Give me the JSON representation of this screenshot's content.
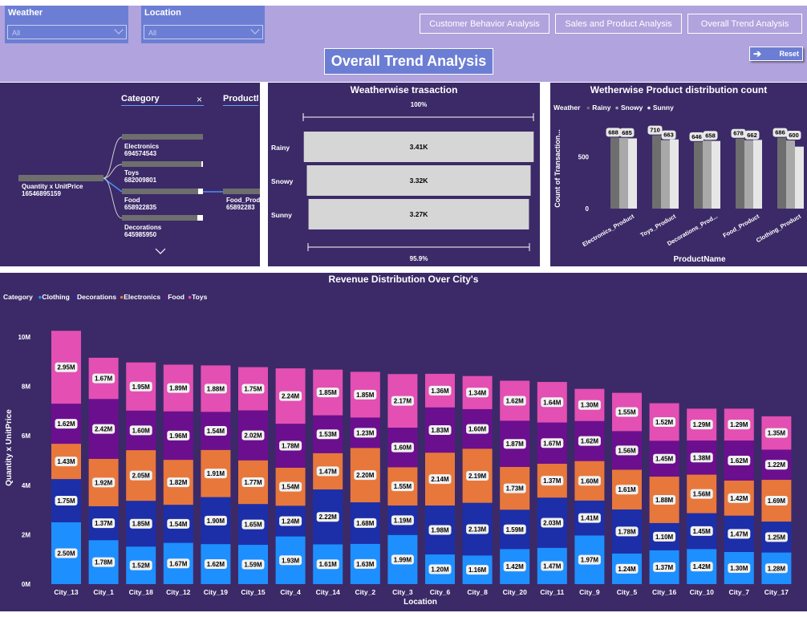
{
  "slicers": {
    "weather": {
      "label": "Weather",
      "value": "All"
    },
    "location": {
      "label": "Location",
      "value": "All"
    }
  },
  "nav": {
    "customer": "Customer Behavior Analysis",
    "sales": "Sales and Product Analysis",
    "overall": "Overall Trend Analysis"
  },
  "page_title": "Overall Trend Analysis",
  "reset_label": "Reset",
  "tree": {
    "col1": "Category",
    "col2": "ProductN",
    "root_label": "Quantity x UnitPrice",
    "root_value": "16546895159",
    "nodes": [
      {
        "label": "Electronics",
        "value": "694574543"
      },
      {
        "label": "Toys",
        "value": "682009801"
      },
      {
        "label": "Food",
        "value": "658922835"
      },
      {
        "label": "Decorations",
        "value": "645985950"
      }
    ],
    "child_label": "Food_Prod",
    "child_value": "65892283"
  },
  "weather_funnel": {
    "title": "Weatherwise trasaction",
    "top_pct": "100%",
    "bottom_pct": "95.9%",
    "colors": {
      "bar": "#d6d6d6"
    }
  },
  "product_chart": {
    "title": "Wetherwise Product distribution count",
    "legend_title": "Weather",
    "colors": {
      "Rainy": "#6e6e6e",
      "Snowy": "#a9a9a9",
      "Sunny": "#e6e6e6"
    }
  },
  "revenue_chart": {
    "title": "Revenue Distribution Over City's",
    "legend_title": "Category",
    "colors": {
      "Clothing": "#1e8fff",
      "Decorations": "#1c2fa8",
      "Electronics": "#e8773c",
      "Food": "#6b0f8f",
      "Toys": "#e34fb3"
    }
  },
  "chart_data": [
    {
      "type": "bar",
      "title": "Weatherwise trasaction",
      "categories": [
        "Rainy",
        "Snowy",
        "Sunny"
      ],
      "values": [
        3410,
        3320,
        3270
      ],
      "labels": [
        "3.41K",
        "3.32K",
        "3.27K"
      ]
    },
    {
      "type": "bar",
      "title": "Wetherwise Product distribution count",
      "xlabel": "ProductName",
      "ylabel": "Count of Transaction...",
      "categories": [
        "Electronics_Product",
        "Toys_Product",
        "Decorations_Prod...",
        "Food_Product",
        "Clothing_Product"
      ],
      "series": [
        {
          "name": "Rainy",
          "values": [
            688,
            710,
            646,
            678,
            686
          ]
        },
        {
          "name": "Snowy",
          "values": [
            685,
            663,
            658,
            662,
            660
          ]
        },
        {
          "name": "Sunny",
          "values": [
            680,
            670,
            655,
            665,
            600
          ]
        }
      ],
      "labels": [
        [
          "688",
          "685"
        ],
        [
          "710",
          "663"
        ],
        [
          "646",
          "658"
        ],
        [
          "678",
          "662"
        ],
        [
          "686",
          "600"
        ]
      ],
      "yticks": [
        "0",
        "500"
      ],
      "ylim": [
        0,
        800
      ]
    },
    {
      "type": "bar",
      "stacked": true,
      "title": "Revenue Distribution Over City's",
      "xlabel": "Location",
      "ylabel": "Quantity x UnitPrice",
      "yticks": [
        "0M",
        "2M",
        "4M",
        "6M",
        "8M",
        "10M"
      ],
      "ylim": [
        0,
        10.5
      ],
      "categories": [
        "City_13",
        "City_1",
        "City_18",
        "City_12",
        "City_19",
        "City_15",
        "City_4",
        "City_14",
        "City_2",
        "City_3",
        "City_6",
        "City_8",
        "City_20",
        "City_11",
        "City_9",
        "City_5",
        "City_16",
        "City_10",
        "City_7",
        "City_17"
      ],
      "series": [
        {
          "name": "Clothing",
          "values": [
            2.5,
            1.78,
            1.52,
            1.67,
            1.62,
            1.59,
            1.93,
            1.61,
            1.63,
            1.99,
            1.2,
            1.16,
            1.42,
            1.47,
            1.97,
            1.24,
            1.37,
            1.42,
            1.3,
            1.28
          ]
        },
        {
          "name": "Decorations",
          "values": [
            1.75,
            1.37,
            1.85,
            1.54,
            1.9,
            1.65,
            1.24,
            2.22,
            1.68,
            1.19,
            1.98,
            2.13,
            1.59,
            2.03,
            1.41,
            1.78,
            1.1,
            1.45,
            1.47,
            1.25
          ]
        },
        {
          "name": "Electronics",
          "values": [
            1.43,
            1.92,
            2.05,
            1.82,
            1.91,
            1.77,
            1.54,
            1.47,
            2.2,
            1.55,
            2.14,
            2.19,
            1.73,
            1.37,
            1.6,
            1.61,
            1.88,
            1.56,
            1.42,
            1.69
          ]
        },
        {
          "name": "Food",
          "values": [
            1.62,
            2.42,
            1.6,
            1.96,
            1.54,
            2.02,
            1.78,
            1.53,
            1.23,
            1.6,
            1.83,
            1.6,
            1.87,
            1.67,
            1.62,
            1.56,
            1.45,
            1.38,
            1.62,
            1.22
          ]
        },
        {
          "name": "Toys",
          "values": [
            2.95,
            1.67,
            1.95,
            1.89,
            1.88,
            1.75,
            2.24,
            1.85,
            1.85,
            2.17,
            1.36,
            1.34,
            1.62,
            1.64,
            1.3,
            1.55,
            1.52,
            1.29,
            1.29,
            1.35
          ]
        }
      ]
    }
  ]
}
